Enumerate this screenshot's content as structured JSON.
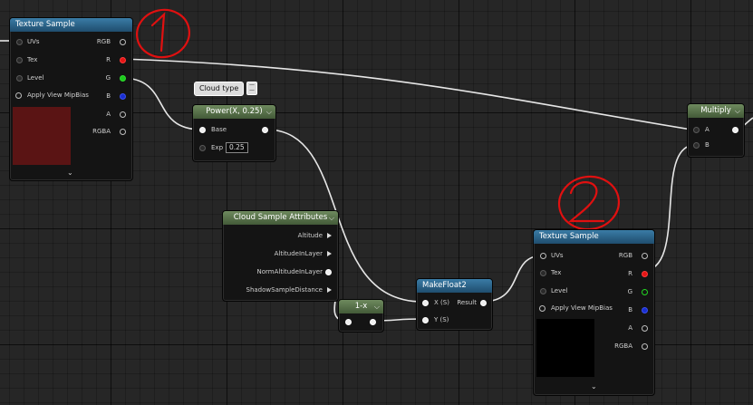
{
  "annotations": [
    "1",
    "2"
  ],
  "comment_bubble": "Cloud type",
  "nodes": {
    "texture_sample_1": {
      "title": "Texture Sample",
      "inputs": [
        "UVs",
        "Tex",
        "Level",
        "Apply View MipBias"
      ],
      "outputs": [
        "RGB",
        "R",
        "G",
        "B",
        "A",
        "RGBA"
      ],
      "preview_color": "#5a1414"
    },
    "power": {
      "title": "Power(X, 0.25)",
      "inputs": [
        "Base",
        "Exp"
      ],
      "exp_value": "0.25"
    },
    "multiply": {
      "title": "Multiply",
      "inputs": [
        "A",
        "B"
      ]
    },
    "cloud_sample_attributes": {
      "title": "Cloud Sample Attributes",
      "outputs": [
        "Altitude",
        "AltitudeInLayer",
        "NormAltitudeInLayer",
        "ShadowSampleDistance"
      ]
    },
    "one_minus": {
      "title": "1-x"
    },
    "make_float2": {
      "title": "MakeFloat2",
      "inputs": [
        "X (S)",
        "Y (S)"
      ],
      "outputs": [
        "Result"
      ]
    },
    "texture_sample_2": {
      "title": "Texture Sample",
      "inputs": [
        "UVs",
        "Tex",
        "Level",
        "Apply View MipBias"
      ],
      "outputs": [
        "RGB",
        "R",
        "G",
        "B",
        "A",
        "RGBA"
      ],
      "preview_color": "#000000"
    }
  },
  "colors": {
    "annotation_red": "#e01010",
    "header_blue": "#2d6a94",
    "header_green": "#5a744c",
    "wire": "#e8e8e8"
  }
}
